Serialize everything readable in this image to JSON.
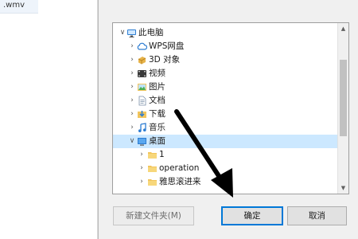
{
  "background_panel": {
    "file_name": ".wmv"
  },
  "tree": {
    "items": [
      {
        "label": "此电脑",
        "expanded": true,
        "selected": false,
        "icon": "computer-icon"
      },
      {
        "label": "WPS网盘",
        "expanded": false,
        "selected": false,
        "icon": "cloud-icon"
      },
      {
        "label": "3D 对象",
        "expanded": false,
        "selected": false,
        "icon": "3d-objects-icon"
      },
      {
        "label": "视频",
        "expanded": false,
        "selected": false,
        "icon": "video-folder-icon"
      },
      {
        "label": "图片",
        "expanded": false,
        "selected": false,
        "icon": "pictures-folder-icon"
      },
      {
        "label": "文档",
        "expanded": false,
        "selected": false,
        "icon": "documents-folder-icon"
      },
      {
        "label": "下载",
        "expanded": false,
        "selected": false,
        "icon": "downloads-folder-icon"
      },
      {
        "label": "音乐",
        "expanded": false,
        "selected": false,
        "icon": "music-folder-icon"
      },
      {
        "label": "桌面",
        "expanded": true,
        "selected": true,
        "icon": "desktop-folder-icon"
      },
      {
        "label": "1",
        "expanded": false,
        "selected": false,
        "icon": "folder-icon"
      },
      {
        "label": "operation",
        "expanded": false,
        "selected": false,
        "icon": "folder-icon"
      },
      {
        "label": "雅思滚进来",
        "expanded": false,
        "selected": false,
        "icon": "folder-icon"
      }
    ]
  },
  "buttons": {
    "new_folder": "新建文件夹(M)",
    "ok": "确定",
    "cancel": "取消"
  },
  "colors": {
    "selection": "#cce8ff",
    "accent": "#0078d7",
    "arrow": "#000000"
  }
}
